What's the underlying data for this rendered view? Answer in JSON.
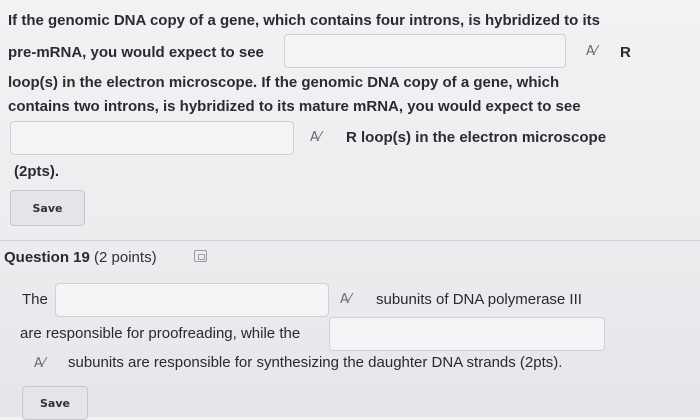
{
  "question18": {
    "line1": "If the genomic DNA copy of a gene, which contains four introns, is hybridized to its",
    "line2_prefix": "pre-mRNA, you would expect to see",
    "line2_suffix": "R",
    "line3": "loop(s) in the electron microscope. If the genomic DNA copy of a gene, which",
    "line4": "contains two introns, is hybridized to its mature mRNA, you would expect to see",
    "line5_suffix": "R loop(s) in the electron microscope",
    "line6": "(2pts).",
    "field1_value": "",
    "field2_value": "",
    "save_label": "Save"
  },
  "question19": {
    "title": "Question 19",
    "points": "(2 points)",
    "line1_prefix": "The",
    "line1_suffix": "subunits of DNA polymerase III",
    "line2": "are responsible for proofreading, while the",
    "line3": "subunits are responsible for synthesizing the daughter DNA strands (2pts).",
    "field1_value": "",
    "field2_value": "",
    "save_label": "Save"
  },
  "icons": {
    "spellcheck": "A⁄",
    "question": "document-icon"
  }
}
